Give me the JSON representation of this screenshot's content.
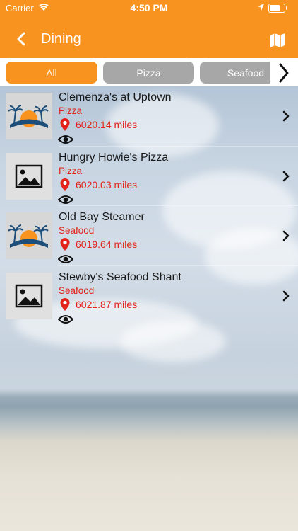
{
  "status_bar": {
    "carrier": "Carrier",
    "time": "4:50 PM",
    "icons": [
      "wifi-icon",
      "location-arrow-icon",
      "battery-icon"
    ],
    "battery_level": 0.7
  },
  "nav": {
    "title": "Dining",
    "left_icon": "chevron-left-icon",
    "right_icon": "map-icon"
  },
  "colors": {
    "accent": "#f7931e",
    "inactive_tab": "#a7a7a7",
    "category_text": "#e2231a"
  },
  "tabs": [
    {
      "label": "All",
      "selected": true
    },
    {
      "label": "Pizza",
      "selected": false
    },
    {
      "label": "Seafood",
      "selected": false
    }
  ],
  "restaurants": [
    {
      "name": "Clemenza's at Uptown",
      "category": "Pizza",
      "distance": "6020.14 miles",
      "image": "beach-logo"
    },
    {
      "name": "Hungry Howie's Pizza",
      "category": "Pizza",
      "distance": "6020.03 miles",
      "image": "placeholder-photo-icon"
    },
    {
      "name": "Old Bay Steamer",
      "category": "Seafood",
      "distance": "6019.64 miles",
      "image": "beach-logo"
    },
    {
      "name": "Stewby's Seafood Shant",
      "category": "Seafood",
      "distance": "6021.87 miles",
      "image": "placeholder-photo-icon"
    }
  ]
}
